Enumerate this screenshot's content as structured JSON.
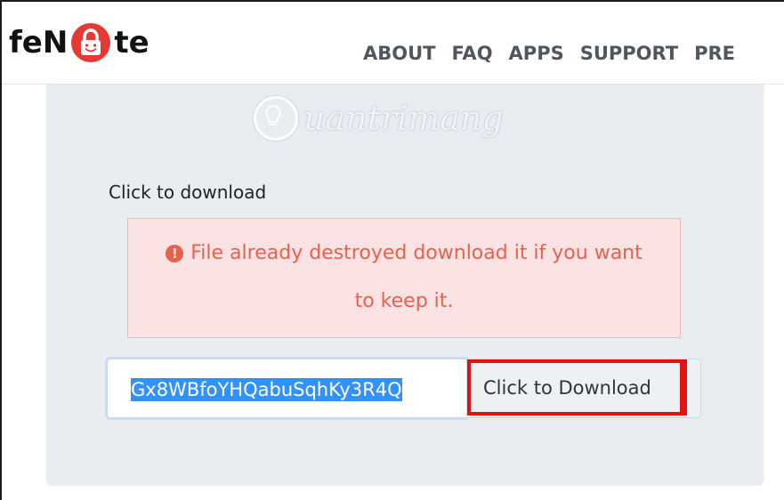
{
  "brand": {
    "logo_prefix": "feN",
    "logo_suffix": "te",
    "accent_color": "#e53935"
  },
  "nav": {
    "items": [
      {
        "label": "ABOUT"
      },
      {
        "label": "FAQ"
      },
      {
        "label": "APPS"
      },
      {
        "label": "SUPPORT"
      },
      {
        "label": "PRE"
      }
    ]
  },
  "watermark": {
    "text": "uantrimang",
    "icon": "lightbulb-icon"
  },
  "download_section": {
    "title": "Click to download",
    "alert": {
      "icon": "exclamation-circle-icon",
      "line1": "File already destroyed download it if you want",
      "line2": "to keep it.",
      "color": "#e9604f"
    },
    "code_value": "Gx8WBfoYHQabuSqhKy3R4Q",
    "button_label": "Click to Download",
    "highlight_color": "#e31212"
  }
}
